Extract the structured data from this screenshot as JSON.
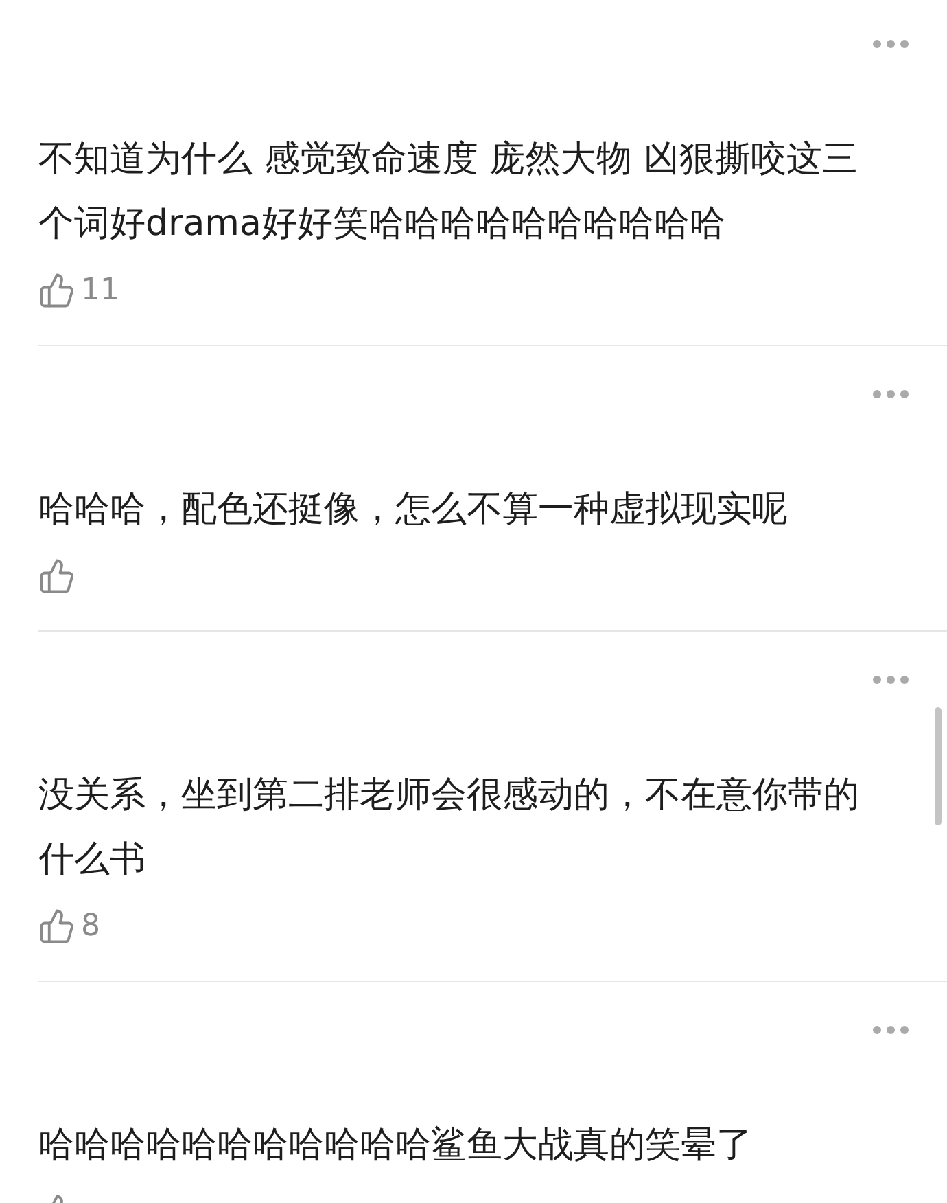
{
  "comments": [
    {
      "text": "不知道为什么 感觉致命速度 庞然大物 凶狠撕咬这三个词好drama好好笑哈哈哈哈哈哈哈哈哈哈",
      "likes": "11"
    },
    {
      "text": "哈哈哈，配色还挺像，怎么不算一种虚拟现实呢"
    },
    {
      "text": "没关系，坐到第二排老师会很感动的，不在意你带的什么书",
      "likes": "8"
    },
    {
      "text": "哈哈哈哈哈哈哈哈哈哈哈鲨鱼大战真的笑晕了"
    }
  ]
}
